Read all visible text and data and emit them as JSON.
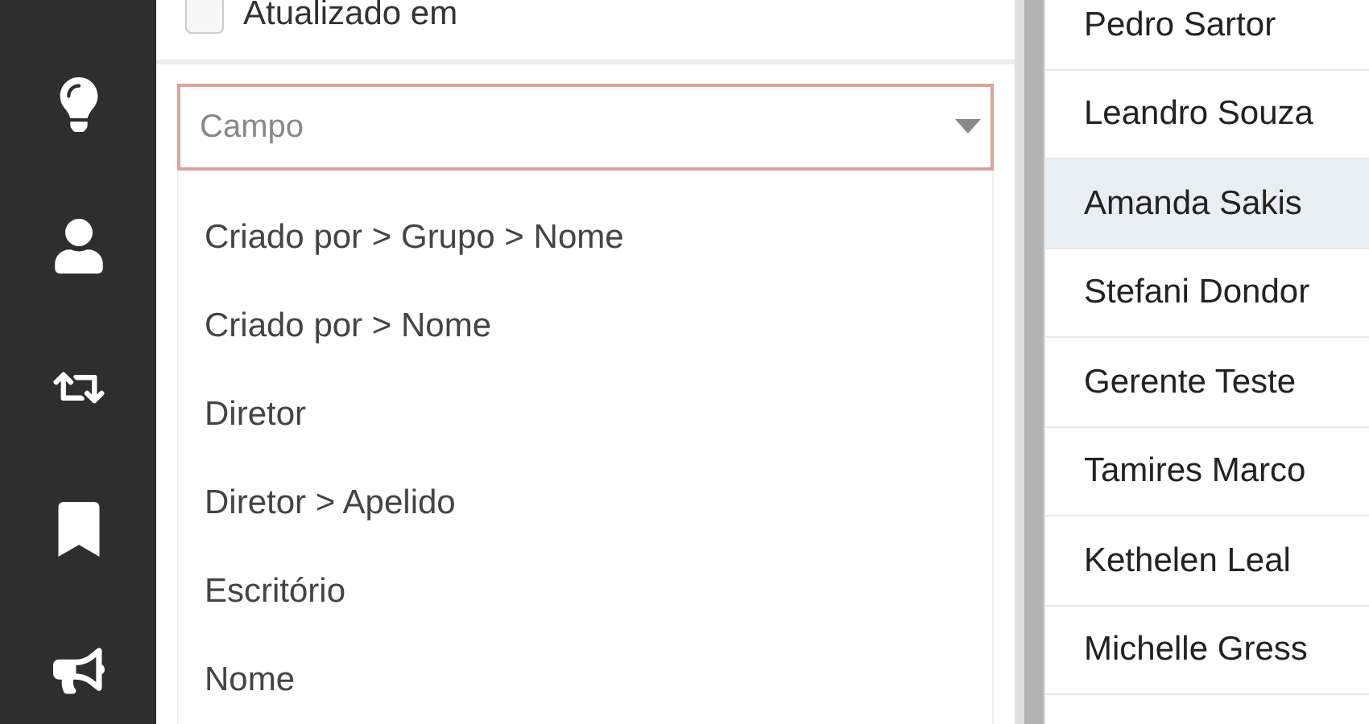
{
  "sidebar": {
    "items": [
      {
        "kind": "bulb"
      },
      {
        "kind": "user"
      },
      {
        "kind": "retweet"
      },
      {
        "kind": "bookmark"
      },
      {
        "kind": "megaphone"
      }
    ]
  },
  "filter": {
    "checkbox": {
      "label": "Atualizado em",
      "checked": false
    },
    "select": {
      "placeholder": "Campo",
      "options": [
        "Criado por > Grupo > Nome",
        "Criado por > Nome",
        "Diretor",
        "Diretor > Apelido",
        "Escritório",
        "Nome"
      ]
    }
  },
  "people": [
    {
      "name": "Pedro Sartor",
      "selected": false
    },
    {
      "name": "Leandro Souza",
      "selected": false
    },
    {
      "name": "Amanda Sakis",
      "selected": true
    },
    {
      "name": "Stefani Dondor",
      "selected": false
    },
    {
      "name": "Gerente Teste",
      "selected": false
    },
    {
      "name": "Tamires Marco",
      "selected": false
    },
    {
      "name": "Kethelen Leal",
      "selected": false
    },
    {
      "name": "Michelle Gress",
      "selected": false
    }
  ]
}
